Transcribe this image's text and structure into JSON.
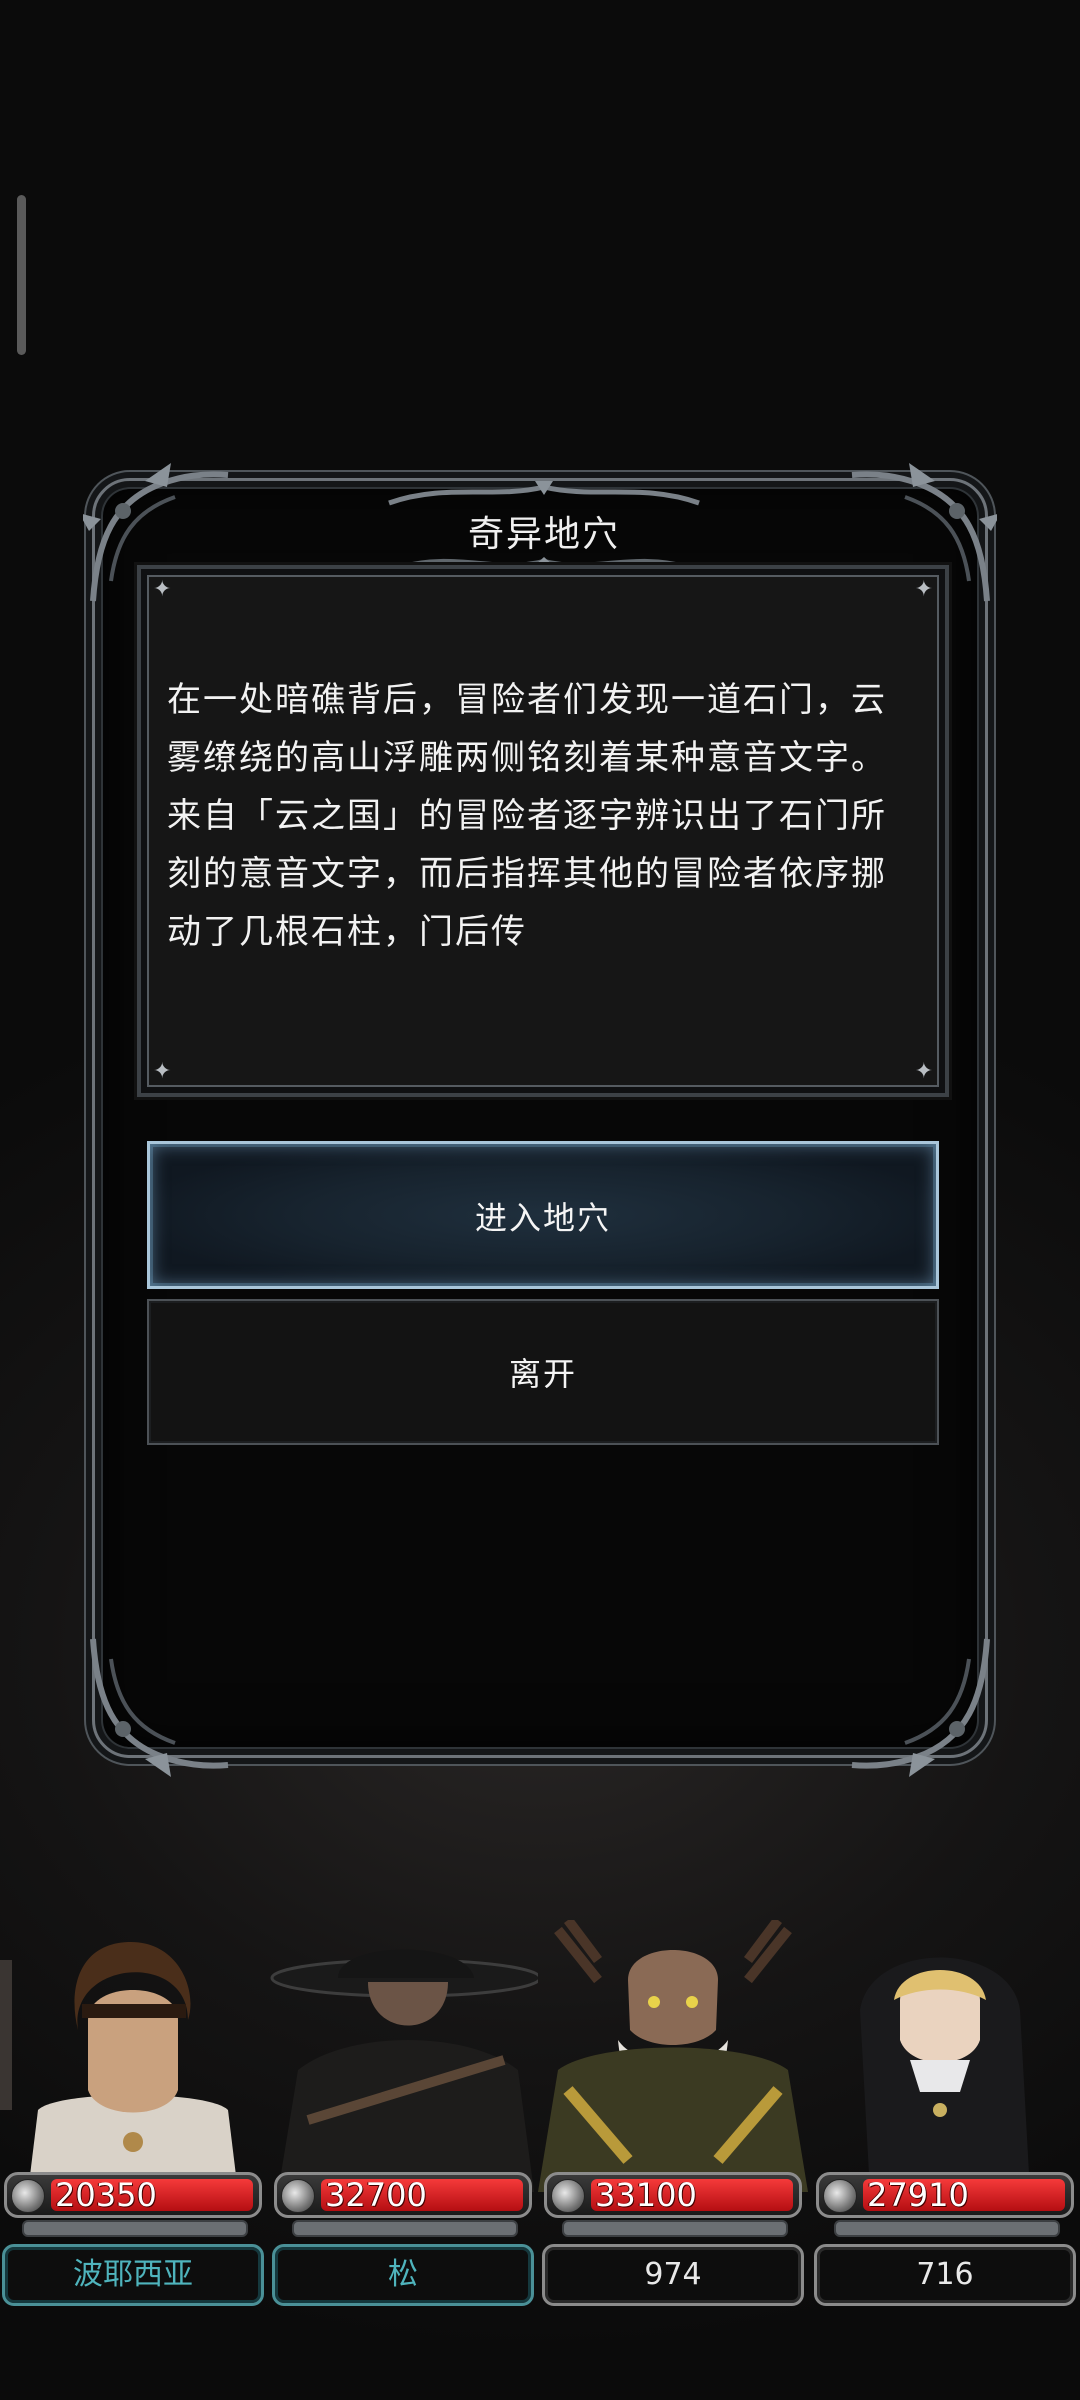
{
  "dialog": {
    "title": "奇异地穴",
    "story": "在一处暗礁背后，冒险者们发现一道石门，云雾缭绕的高山浮雕两侧铭刻着某种意音文字。来自「云之国」的冒险者逐字辨识出了石门所刻的意音文字，而后指挥其他的冒险者依序挪动了几根石柱，门后传",
    "choices": {
      "enter_label": "进入地穴",
      "leave_label": "离开"
    }
  },
  "party": [
    {
      "hp": "20350",
      "name": "波耶西亚",
      "plate_style": "teal"
    },
    {
      "hp": "32700",
      "name": "松",
      "plate_style": "teal"
    },
    {
      "hp": "33100",
      "name": "974",
      "plate_style": "plain"
    },
    {
      "hp": "27910",
      "name": "716",
      "plate_style": "plain"
    }
  ],
  "colors": {
    "accent_teal": "#4fb4bd",
    "hp_red": "#d61a1e",
    "selected_border": "#a9c6da"
  },
  "icons": {
    "hp": "sword-orb-icon",
    "corner": "sparkle-icon"
  }
}
